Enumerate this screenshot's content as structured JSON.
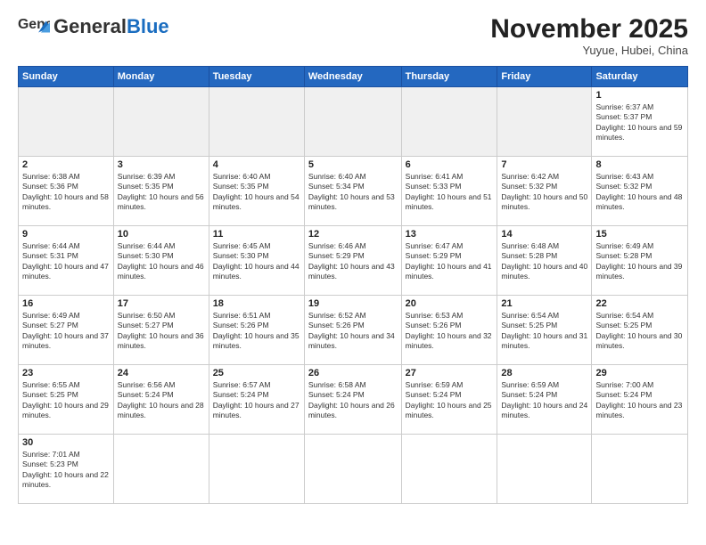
{
  "header": {
    "logo_general": "General",
    "logo_blue": "Blue",
    "month_title": "November 2025",
    "subtitle": "Yuyue, Hubei, China"
  },
  "weekdays": [
    "Sunday",
    "Monday",
    "Tuesday",
    "Wednesday",
    "Thursday",
    "Friday",
    "Saturday"
  ],
  "days": {
    "1": {
      "sunrise": "6:37 AM",
      "sunset": "5:37 PM",
      "daylight": "10 hours and 59 minutes."
    },
    "2": {
      "sunrise": "6:38 AM",
      "sunset": "5:36 PM",
      "daylight": "10 hours and 58 minutes."
    },
    "3": {
      "sunrise": "6:39 AM",
      "sunset": "5:35 PM",
      "daylight": "10 hours and 56 minutes."
    },
    "4": {
      "sunrise": "6:40 AM",
      "sunset": "5:35 PM",
      "daylight": "10 hours and 54 minutes."
    },
    "5": {
      "sunrise": "6:40 AM",
      "sunset": "5:34 PM",
      "daylight": "10 hours and 53 minutes."
    },
    "6": {
      "sunrise": "6:41 AM",
      "sunset": "5:33 PM",
      "daylight": "10 hours and 51 minutes."
    },
    "7": {
      "sunrise": "6:42 AM",
      "sunset": "5:32 PM",
      "daylight": "10 hours and 50 minutes."
    },
    "8": {
      "sunrise": "6:43 AM",
      "sunset": "5:32 PM",
      "daylight": "10 hours and 48 minutes."
    },
    "9": {
      "sunrise": "6:44 AM",
      "sunset": "5:31 PM",
      "daylight": "10 hours and 47 minutes."
    },
    "10": {
      "sunrise": "6:44 AM",
      "sunset": "5:30 PM",
      "daylight": "10 hours and 46 minutes."
    },
    "11": {
      "sunrise": "6:45 AM",
      "sunset": "5:30 PM",
      "daylight": "10 hours and 44 minutes."
    },
    "12": {
      "sunrise": "6:46 AM",
      "sunset": "5:29 PM",
      "daylight": "10 hours and 43 minutes."
    },
    "13": {
      "sunrise": "6:47 AM",
      "sunset": "5:29 PM",
      "daylight": "10 hours and 41 minutes."
    },
    "14": {
      "sunrise": "6:48 AM",
      "sunset": "5:28 PM",
      "daylight": "10 hours and 40 minutes."
    },
    "15": {
      "sunrise": "6:49 AM",
      "sunset": "5:28 PM",
      "daylight": "10 hours and 39 minutes."
    },
    "16": {
      "sunrise": "6:49 AM",
      "sunset": "5:27 PM",
      "daylight": "10 hours and 37 minutes."
    },
    "17": {
      "sunrise": "6:50 AM",
      "sunset": "5:27 PM",
      "daylight": "10 hours and 36 minutes."
    },
    "18": {
      "sunrise": "6:51 AM",
      "sunset": "5:26 PM",
      "daylight": "10 hours and 35 minutes."
    },
    "19": {
      "sunrise": "6:52 AM",
      "sunset": "5:26 PM",
      "daylight": "10 hours and 34 minutes."
    },
    "20": {
      "sunrise": "6:53 AM",
      "sunset": "5:26 PM",
      "daylight": "10 hours and 32 minutes."
    },
    "21": {
      "sunrise": "6:54 AM",
      "sunset": "5:25 PM",
      "daylight": "10 hours and 31 minutes."
    },
    "22": {
      "sunrise": "6:54 AM",
      "sunset": "5:25 PM",
      "daylight": "10 hours and 30 minutes."
    },
    "23": {
      "sunrise": "6:55 AM",
      "sunset": "5:25 PM",
      "daylight": "10 hours and 29 minutes."
    },
    "24": {
      "sunrise": "6:56 AM",
      "sunset": "5:24 PM",
      "daylight": "10 hours and 28 minutes."
    },
    "25": {
      "sunrise": "6:57 AM",
      "sunset": "5:24 PM",
      "daylight": "10 hours and 27 minutes."
    },
    "26": {
      "sunrise": "6:58 AM",
      "sunset": "5:24 PM",
      "daylight": "10 hours and 26 minutes."
    },
    "27": {
      "sunrise": "6:59 AM",
      "sunset": "5:24 PM",
      "daylight": "10 hours and 25 minutes."
    },
    "28": {
      "sunrise": "6:59 AM",
      "sunset": "5:24 PM",
      "daylight": "10 hours and 24 minutes."
    },
    "29": {
      "sunrise": "7:00 AM",
      "sunset": "5:24 PM",
      "daylight": "10 hours and 23 minutes."
    },
    "30": {
      "sunrise": "7:01 AM",
      "sunset": "5:23 PM",
      "daylight": "10 hours and 22 minutes."
    }
  }
}
